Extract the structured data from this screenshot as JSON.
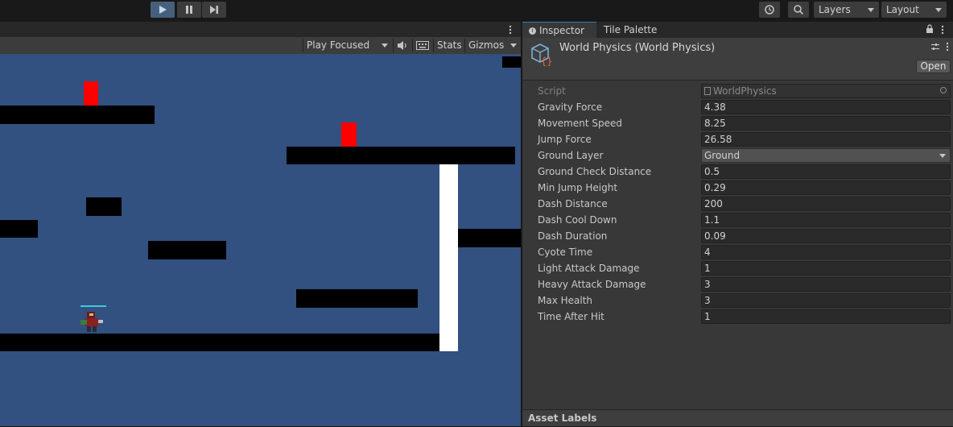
{
  "toolbar": {
    "play_icon": "play-icon",
    "pause_icon": "pause-icon",
    "step_icon": "step-icon",
    "history_icon": "history-icon",
    "search_icon": "search-icon",
    "layers_label": "Layers",
    "layout_label": "Layout"
  },
  "game_view": {
    "play_mode_label": "Play Focused",
    "stats_label": "Stats",
    "gizmos_label": "Gizmos",
    "audio_icon": "speaker-icon",
    "keyboard_icon": "keyboard-icon",
    "menu_icon": "kebab-menu-icon"
  },
  "inspector": {
    "tabs": [
      "Inspector",
      "Tile Palette"
    ],
    "component_title": "World Physics (World Physics)",
    "open_button": "Open",
    "script_label": "Script",
    "script_value": "WorldPhysics",
    "properties": [
      {
        "label": "Gravity Force",
        "value": "4.38"
      },
      {
        "label": "Movement Speed",
        "value": "8.25"
      },
      {
        "label": "Jump Force",
        "value": "26.58"
      },
      {
        "label": "Ground Layer",
        "value": "Ground"
      },
      {
        "label": "Ground Check Distance",
        "value": "0.5"
      },
      {
        "label": "Min Jump Height",
        "value": "0.29"
      },
      {
        "label": "Dash Distance",
        "value": "200"
      },
      {
        "label": "Dash Cool Down",
        "value": "1.1"
      },
      {
        "label": "Dash Duration",
        "value": "0.09"
      },
      {
        "label": "Cyote Time",
        "value": "4"
      },
      {
        "label": "Light Attack Damage",
        "value": "1"
      },
      {
        "label": "Heavy Attack Damage",
        "value": "3"
      },
      {
        "label": "Max Health",
        "value": "3"
      },
      {
        "label": "Time After Hit",
        "value": "1"
      }
    ],
    "asset_labels": "Asset Labels"
  },
  "colors": {
    "sky": "#325080",
    "platform": "#000000",
    "hazard": "#ff0000",
    "wall": "#ffffff",
    "accent": "#3a79bb"
  }
}
